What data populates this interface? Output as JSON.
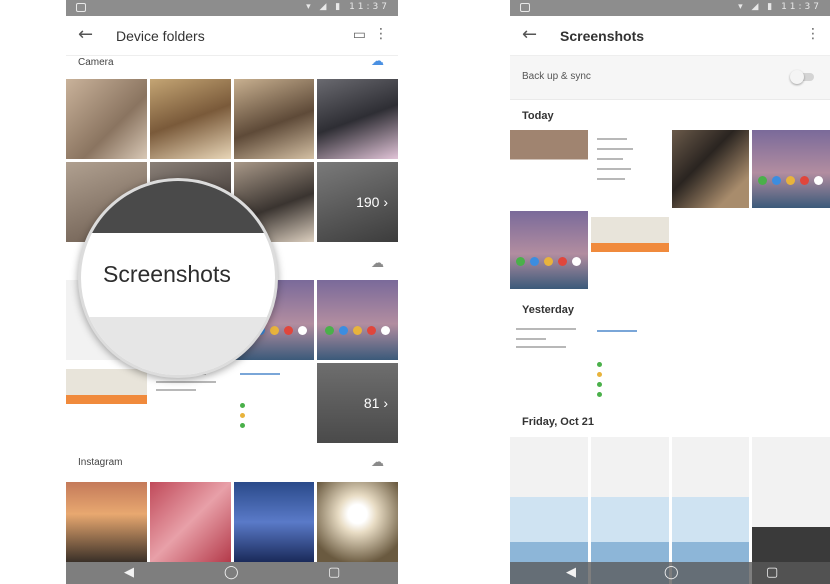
{
  "left_screen": {
    "status_time": "11:37",
    "title": "Device folders",
    "folders": [
      {
        "name": "Camera",
        "count": "190",
        "cloud": "cloud-upload-icon"
      },
      {
        "name": "Screenshots",
        "count": "81",
        "cloud": "cloud-off-icon"
      },
      {
        "name": "Instagram",
        "count": "",
        "cloud": "cloud-off-icon"
      }
    ],
    "magnifier": {
      "label": "Screenshots"
    }
  },
  "right_screen": {
    "status_time": "11:37",
    "title": "Screenshots",
    "backup_sync_label": "Back up & sync",
    "backup_sync_on": false,
    "date_groups": [
      {
        "label": "Today"
      },
      {
        "label": "Yesterday"
      },
      {
        "label": "Friday, Oct 21"
      }
    ]
  },
  "colors": {
    "accent_blue": "#4a90e2",
    "status_bar": "#8d8d8d",
    "orange_banner": "#f08a3c"
  }
}
